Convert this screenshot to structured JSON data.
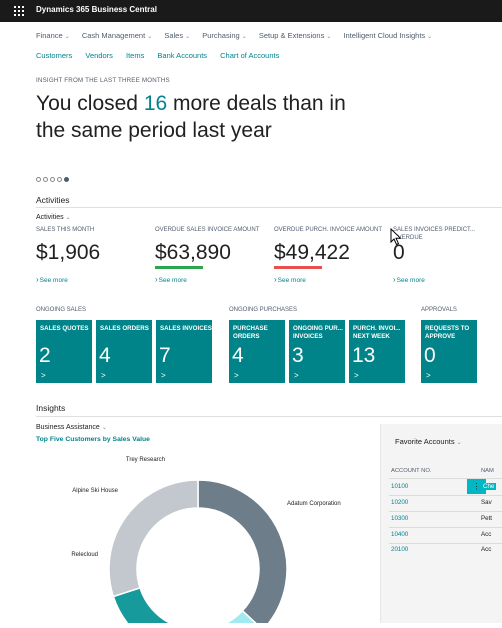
{
  "app": {
    "title": "Dynamics 365 Business Central"
  },
  "nav_primary": [
    "Finance",
    "Cash Management",
    "Sales",
    "Purchasing",
    "Setup & Extensions",
    "Intelligent Cloud Insights"
  ],
  "nav_secondary": [
    "Customers",
    "Vendors",
    "Items",
    "Bank Accounts",
    "Chart of Accounts"
  ],
  "insight": {
    "label": "INSIGHT FROM THE LAST THREE MONTHS",
    "headline_before": "You closed ",
    "headline_number": "16",
    "headline_after": " more deals than in the same period last year"
  },
  "activities": {
    "section_title": "Activities",
    "dropdown_label": "Activities",
    "kpis": [
      {
        "label": "SALES THIS MONTH",
        "value": "$1,906",
        "link": "See more",
        "bar_color": ""
      },
      {
        "label": "OVERDUE SALES INVOICE AMOUNT",
        "value": "$63,890",
        "link": "See more",
        "bar_color": "#2ea44f"
      },
      {
        "label": "OVERDUE PURCH. INVOICE AMOUNT",
        "value": "$49,422",
        "link": "See more",
        "bar_color": "#e8504c"
      },
      {
        "label": "SALES INVOICES PREDICT... OVERDUE",
        "value": "0",
        "link": "See more",
        "bar_color": ""
      }
    ],
    "groups": {
      "ongoing_sales": "ONGOING SALES",
      "ongoing_purchases": "ONGOING PURCHASES",
      "approvals": "APPROVALS"
    },
    "tiles": [
      {
        "label": "SALES QUOTES",
        "value": "2"
      },
      {
        "label": "SALES ORDERS",
        "value": "4"
      },
      {
        "label": "SALES INVOICES",
        "value": "7"
      },
      {
        "label": "PURCHASE ORDERS",
        "value": "4"
      },
      {
        "label": "ONGOING PUR... INVOICES",
        "value": "3"
      },
      {
        "label": "PURCH. INVOI... NEXT WEEK",
        "value": "13"
      },
      {
        "label": "REQUESTS TO APPROVE",
        "value": "0"
      }
    ],
    "tile_arrow": ">"
  },
  "insights": {
    "section_title": "Insights",
    "business_assistance": "Business Assistance",
    "chart_title": "Top Five Customers by Sales Value"
  },
  "chart_data": {
    "type": "pie",
    "title": "Top Five Customers by Sales Value",
    "categories": [
      "Adatum Corporation",
      "Trey Research",
      "Alpine Ski House",
      "Relecloud",
      "Unlabeled segment (partially visible)"
    ],
    "values": [
      37,
      9,
      11,
      13,
      30
    ],
    "colors": [
      "#6e7d8a",
      "#a3eaf0",
      "#2fc8cf",
      "#169a9b",
      "#c3c8cf"
    ],
    "legend": "none"
  },
  "favorites": {
    "title": "Favorite Accounts",
    "col_no": "ACCOUNT NO.",
    "col_name": "NAM",
    "menu_icon": "⋮",
    "rows": [
      {
        "no": "10100",
        "name": "Che"
      },
      {
        "no": "10200",
        "name": "Sav"
      },
      {
        "no": "10300",
        "name": "Pett"
      },
      {
        "no": "10400",
        "name": "Acc"
      },
      {
        "no": "20100",
        "name": "Acc"
      }
    ]
  },
  "colors": {
    "accent": "#00838f",
    "tile": "#008489",
    "topbar": "#1a1a1a"
  }
}
